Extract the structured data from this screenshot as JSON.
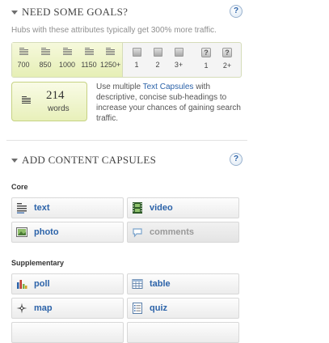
{
  "goals": {
    "title": "NEED SOME GOALS?",
    "help_label": "?",
    "subtitle": "Hubs with these attributes typically get 300% more traffic.",
    "targets": [
      {
        "label": "700",
        "icon": "text-lines-icon"
      },
      {
        "label": "850",
        "icon": "text-lines-icon"
      },
      {
        "label": "1000",
        "icon": "text-lines-icon"
      },
      {
        "label": "1150",
        "icon": "text-lines-icon"
      },
      {
        "label": "1250+",
        "icon": "text-lines-icon"
      },
      {
        "label": "1",
        "icon": "photo-box-icon"
      },
      {
        "label": "2",
        "icon": "photo-box-icon"
      },
      {
        "label": "3+",
        "icon": "photo-box-icon"
      },
      {
        "label": "1",
        "icon": "question-box-icon",
        "glyph": "?"
      },
      {
        "label": "2+",
        "icon": "question-box-icon",
        "glyph": "?"
      }
    ],
    "word_count": {
      "value": "214",
      "unit": "words"
    },
    "tip": {
      "before": "Use multiple ",
      "link": "Text Capsules",
      "after": " with descriptive, concise sub-headings to increase your chances of gaining search traffic."
    }
  },
  "capsules": {
    "title": "ADD CONTENT CAPSULES",
    "help_label": "?",
    "core_label": "Core",
    "supplementary_label": "Supplementary",
    "core": [
      {
        "label": "text",
        "icon": "text-icon",
        "enabled": true
      },
      {
        "label": "video",
        "icon": "film-icon",
        "enabled": true
      },
      {
        "label": "photo",
        "icon": "photo-icon",
        "enabled": true
      },
      {
        "label": "comments",
        "icon": "speech-bubble-icon",
        "enabled": false
      }
    ],
    "supplementary": [
      {
        "label": "poll",
        "icon": "bar-chart-icon",
        "enabled": true
      },
      {
        "label": "table",
        "icon": "table-icon",
        "enabled": true
      },
      {
        "label": "map",
        "icon": "compass-icon",
        "enabled": true
      },
      {
        "label": "quiz",
        "icon": "quiz-list-icon",
        "enabled": true
      }
    ]
  }
}
